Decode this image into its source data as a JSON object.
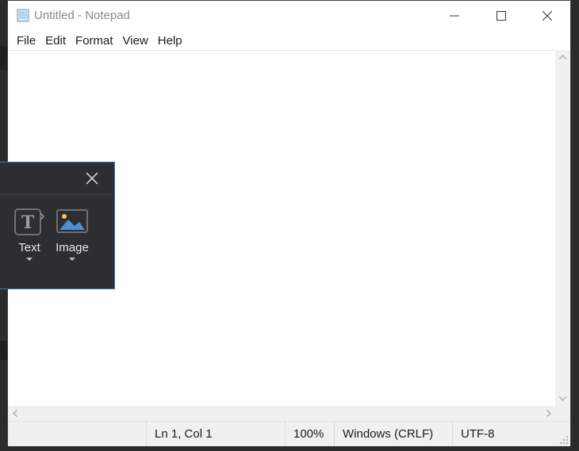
{
  "window": {
    "title": "Untitled - Notepad",
    "controls": [
      "minimize",
      "maximize",
      "close"
    ]
  },
  "menu": [
    "File",
    "Edit",
    "Format",
    "View",
    "Help"
  ],
  "editor": {
    "content": ""
  },
  "statusbar": {
    "position": "Ln 1, Col 1",
    "zoom": "100%",
    "line_ending": "Windows (CRLF)",
    "encoding": "UTF-8"
  },
  "snip_toolbar": {
    "partial_label": "t",
    "tools": [
      {
        "label": "Text",
        "icon": "text-icon"
      },
      {
        "label": "Image",
        "icon": "image-icon"
      }
    ]
  },
  "colors": {
    "snip_bg": "#2d2e31",
    "snip_border": "#3a79c9",
    "image_sky": "#4c8fd6",
    "sun": "#f3c94a"
  }
}
